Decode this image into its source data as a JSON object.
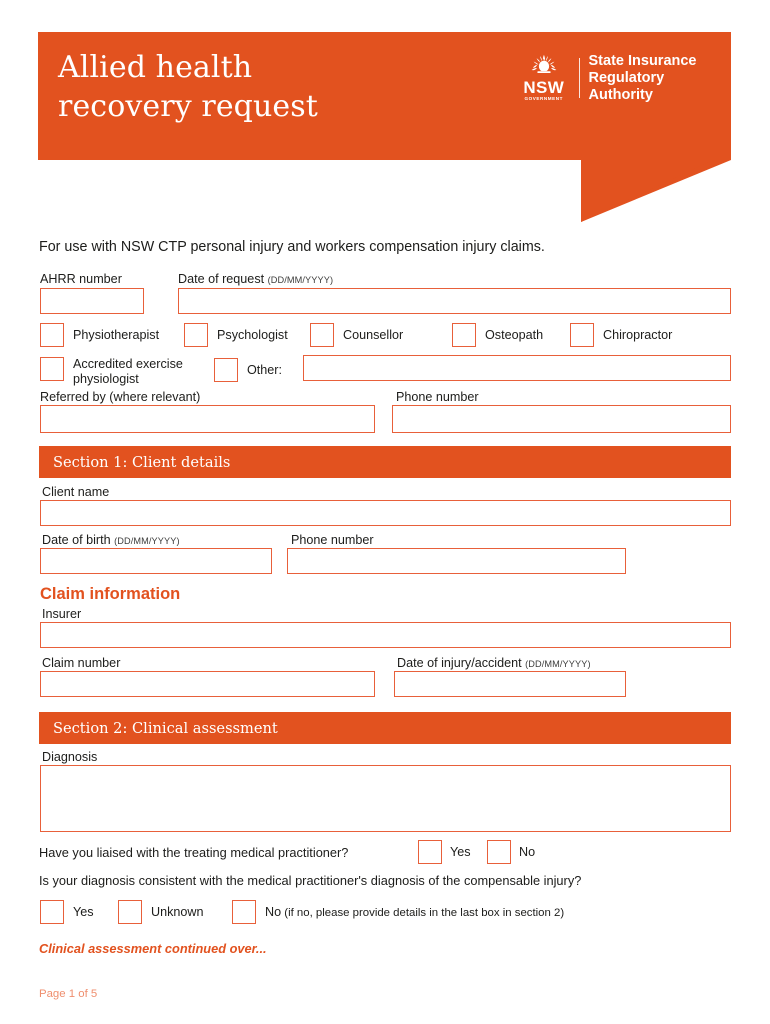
{
  "colors": {
    "brand_orange": "#e2521f",
    "field_border": "#e8603a",
    "footer_text": "#ef8e6e",
    "body_text": "#1d1d1b",
    "white": "#ffffff"
  },
  "header": {
    "title": "Allied health\nrecovery request",
    "logo": {
      "mark_text": "NSW",
      "mark_subtext": "GOVERNMENT",
      "agency_name": "State Insurance\nRegulatory Authority",
      "flower_icon": "nsw-waratah-icon"
    }
  },
  "intro": "For use with NSW CTP personal injury and workers compensation injury claims.",
  "top_fields": {
    "ahrr_number": {
      "label": "AHRR number",
      "value": "",
      "placeholder": ""
    },
    "date_of_request": {
      "label": "Date of request",
      "hint": "(DD/MM/YYYY)",
      "value": "",
      "placeholder": ""
    }
  },
  "profession_checkboxes": [
    {
      "label": "Physiotherapist",
      "checked": false
    },
    {
      "label": "Psychologist",
      "checked": false
    },
    {
      "label": "Counsellor",
      "checked": false
    },
    {
      "label": "Osteopath",
      "checked": false
    },
    {
      "label": "Chiropractor",
      "checked": false
    }
  ],
  "profession_row2": {
    "accredited": {
      "label": "Accredited exercise\nphysiologist",
      "checked": false
    },
    "other": {
      "label": "Other:",
      "checked": false,
      "value": "",
      "placeholder": ""
    }
  },
  "referral": {
    "referred_by": {
      "label": "Referred by (where relevant)",
      "value": "",
      "placeholder": ""
    },
    "phone_number": {
      "label": "Phone number",
      "value": "",
      "placeholder": ""
    }
  },
  "section1": {
    "bar_title": "Section 1: Client details",
    "client_name": {
      "label": "Client name",
      "value": "",
      "placeholder": ""
    },
    "date_of_birth": {
      "label": "Date of birth",
      "hint": "(DD/MM/YYYY)",
      "value": "",
      "placeholder": ""
    },
    "phone_number": {
      "label": "Phone number",
      "value": "",
      "placeholder": ""
    },
    "claim_information": {
      "heading": "Claim information",
      "insurer": {
        "label": "Insurer",
        "value": "",
        "placeholder": ""
      },
      "claim_number": {
        "label": "Claim number",
        "value": "",
        "placeholder": ""
      },
      "date_of_injury": {
        "label": "Date of injury/accident",
        "hint": "(DD/MM/YYYY)",
        "value": "",
        "placeholder": ""
      }
    }
  },
  "section2": {
    "bar_title": "Section 2: Clinical assessment",
    "diagnosis": {
      "label": "Diagnosis",
      "value": "",
      "placeholder": ""
    },
    "liaised_question": {
      "text": "Have you liaised with the treating medical practitioner?",
      "options": [
        {
          "label": "Yes",
          "checked": false
        },
        {
          "label": "No",
          "checked": false
        }
      ]
    },
    "consistent_question": {
      "text": "Is your diagnosis consistent with the medical practitioner's diagnosis of the compensable injury?",
      "options": [
        {
          "label": "Yes",
          "checked": false
        },
        {
          "label": "Unknown",
          "checked": false
        },
        {
          "label": "No",
          "suffix": " (if no, please provide details in the last box in section 2)",
          "checked": false
        }
      ]
    },
    "continued_note": "Clinical assessment continued over..."
  },
  "footer": {
    "page_indicator": "Page 1 of 5"
  }
}
